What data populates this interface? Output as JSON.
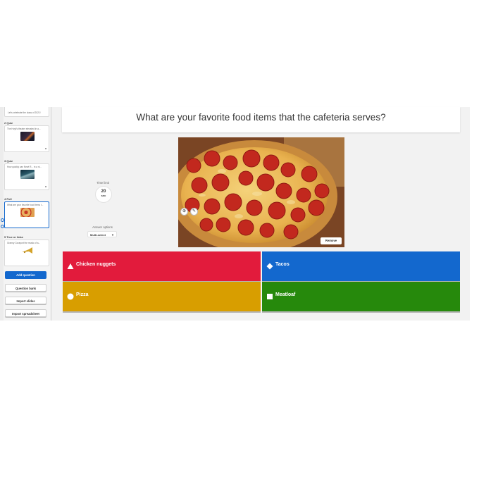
{
  "sidebar": {
    "slides": [
      {
        "head": "",
        "text": "Let's celebrate the class of 2021!"
      },
      {
        "head": "2  Quiz",
        "text": "The Hoyt's theater elevated in a..."
      },
      {
        "head": "3  Quiz",
        "text": "How quickly can Newt R... in a ni..."
      },
      {
        "head": "4  Poll",
        "text": "What are your favorite food items t..."
      },
      {
        "head": "5  True or false",
        "text": "Granny Coraport the music of a..."
      }
    ],
    "buttons": {
      "add_question": "Add question",
      "question_bank": "Question bank",
      "import_slides": "Import slides",
      "import_spreadsheet": "Import spreadsheet"
    }
  },
  "question": {
    "title": "What are your favorite food items that the cafeteria serves?"
  },
  "settings": {
    "time_limit_label": "Time limit",
    "time_limit_value": "20",
    "time_limit_unit": "sec",
    "answer_options_label": "Answer options",
    "answer_options_value": "Multi-select"
  },
  "image": {
    "remove_label": "Remove"
  },
  "answers": [
    {
      "label": "Chicken nuggets",
      "shape": "triangle-icon",
      "color": "#e21b3c"
    },
    {
      "label": "Tacos",
      "shape": "diamond-icon",
      "color": "#1368ce"
    },
    {
      "label": "Pizza",
      "shape": "circle-icon",
      "color": "#d89e00"
    },
    {
      "label": "Meatloaf",
      "shape": "square-icon",
      "color": "#26890c"
    }
  ],
  "colors": {
    "accent": "#1368ce",
    "background": "#f2f2f2",
    "sidebar": "#f4f4f4"
  }
}
